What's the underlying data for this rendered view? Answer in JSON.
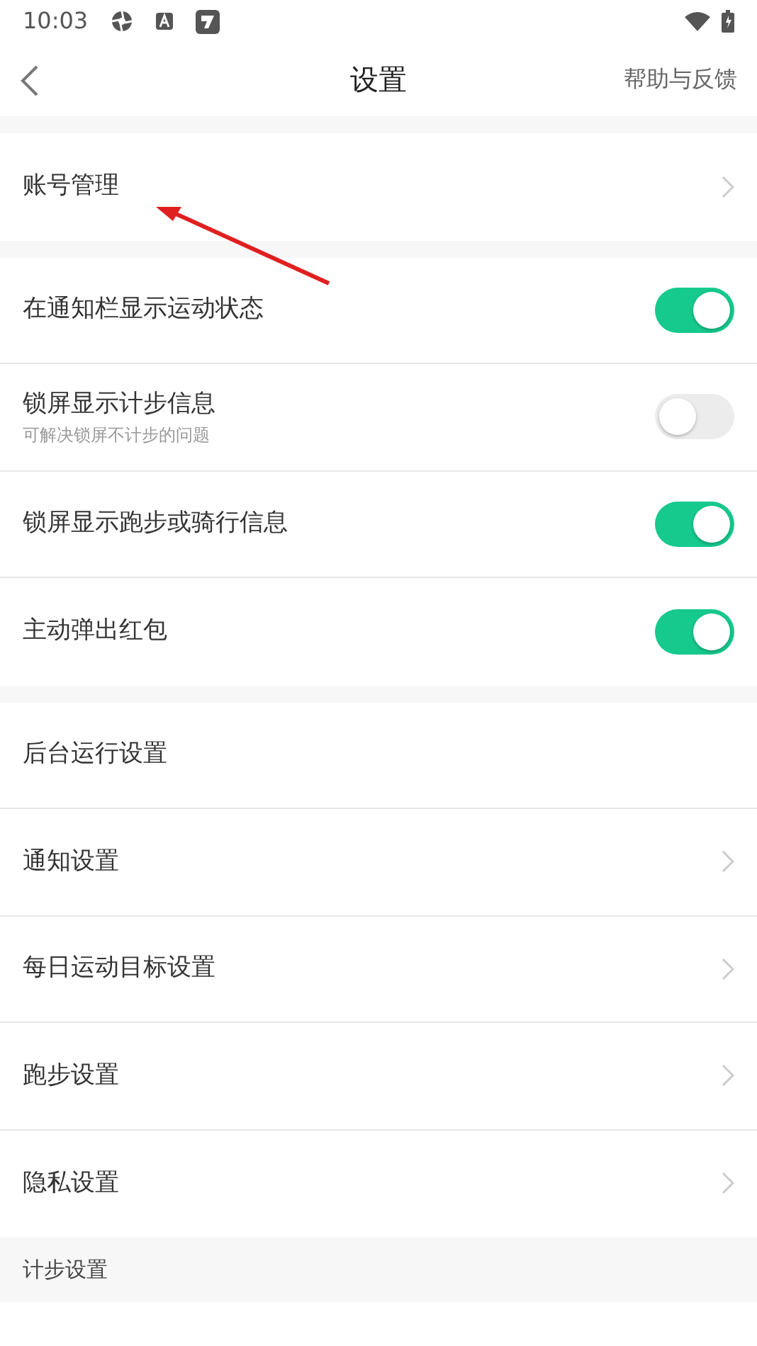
{
  "status_bar": {
    "time": "10:03"
  },
  "header": {
    "title": "设置",
    "action": "帮助与反馈"
  },
  "sections": [
    {
      "items": [
        {
          "kind": "nav",
          "label": "账号管理"
        }
      ]
    },
    {
      "items": [
        {
          "kind": "toggle",
          "label": "在通知栏显示运动状态",
          "on": true
        },
        {
          "kind": "toggle",
          "label": "锁屏显示计步信息",
          "subtitle": "可解决锁屏不计步的问题",
          "on": false
        },
        {
          "kind": "toggle",
          "label": "锁屏显示跑步或骑行信息",
          "on": true
        },
        {
          "kind": "toggle",
          "label": "主动弹出红包",
          "on": true
        }
      ]
    },
    {
      "items": [
        {
          "kind": "plain",
          "label": "后台运行设置"
        },
        {
          "kind": "nav",
          "label": "通知设置"
        },
        {
          "kind": "nav",
          "label": "每日运动目标设置"
        },
        {
          "kind": "nav",
          "label": "跑步设置"
        },
        {
          "kind": "nav",
          "label": "隐私设置"
        }
      ]
    },
    {
      "heading": "计步设置"
    }
  ]
}
